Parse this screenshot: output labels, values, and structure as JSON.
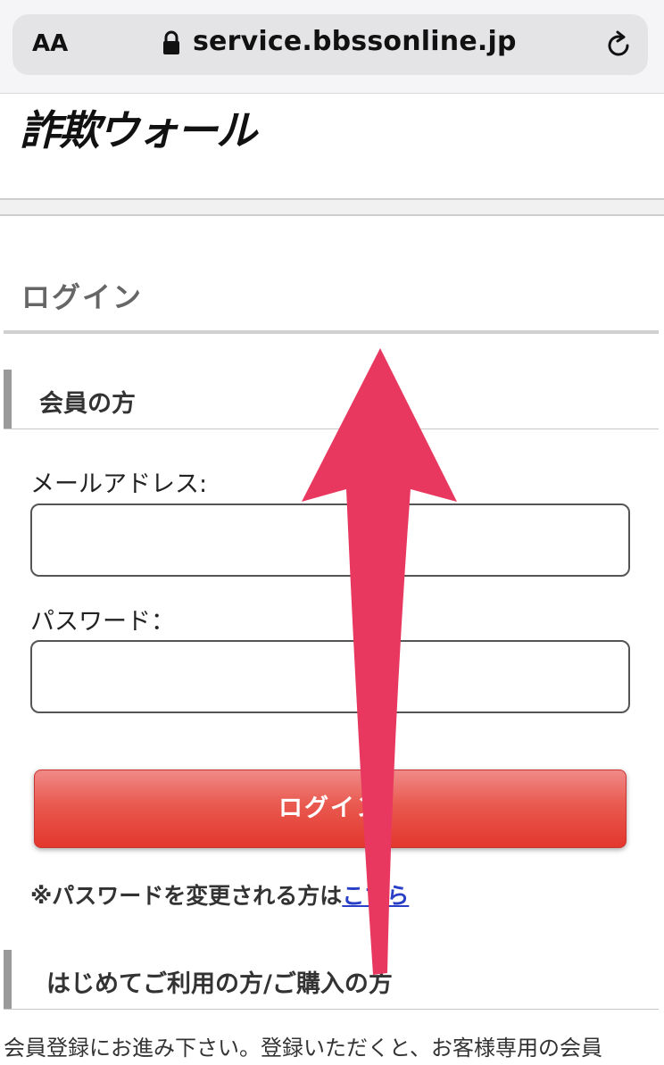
{
  "browser": {
    "text_size_label": "AA",
    "url": "service.bbssonline.jp"
  },
  "site": {
    "logo_text": "詐欺ウォール"
  },
  "page": {
    "title": "ログイン"
  },
  "member_section": {
    "heading": "会員の方",
    "email_label": "メールアドレス:",
    "email_value": "",
    "password_label": "パスワード：",
    "password_value": "",
    "login_button": "ログイン",
    "password_note_prefix": "※パスワードを変更される方は",
    "password_note_link": "こちら"
  },
  "new_section": {
    "heading": "はじめてご利用の方/ご購入の方",
    "intro_text": "会員登録にお進み下さい。登録いただくと、お客様専用の会員"
  },
  "overlay": {
    "arrow_color": "#e8385f",
    "direction": "up"
  }
}
